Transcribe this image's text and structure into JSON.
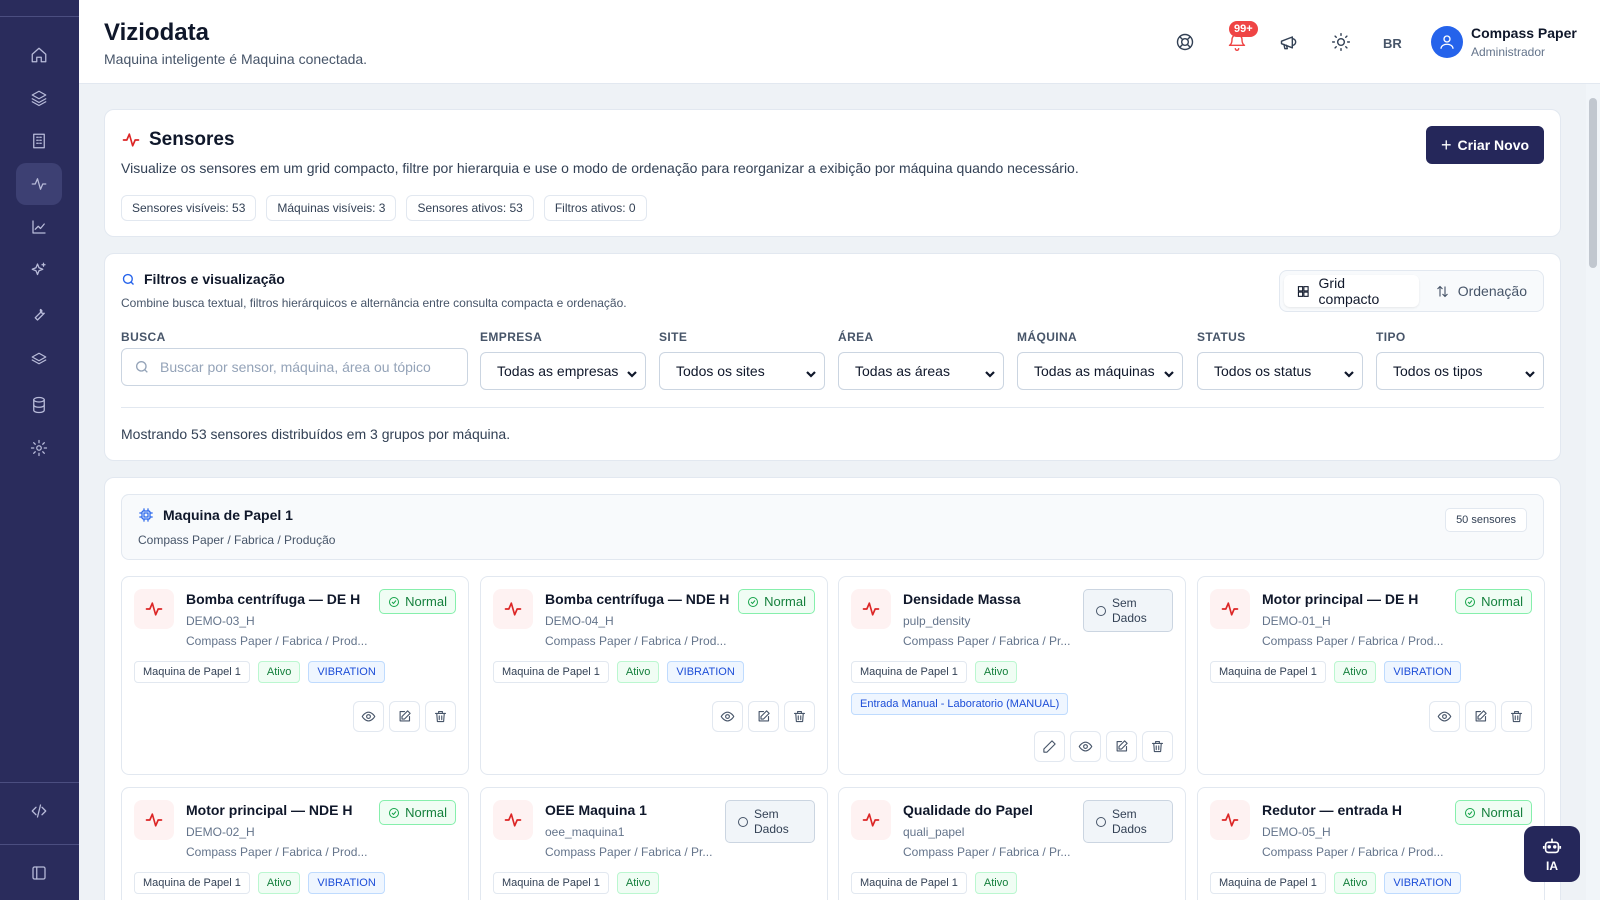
{
  "header": {
    "title": "Viziodata",
    "subtitle": "Maquina inteligente é Maquina conectada.",
    "notif_count": "99+",
    "lang": "BR",
    "user_name": "Compass Paper",
    "user_role": "Administrador"
  },
  "sidebar": {
    "items": [
      "home-icon",
      "layers-icon",
      "building-icon",
      "activity-icon",
      "chart-icon",
      "sparkles-icon",
      "wrench-icon",
      "stack-icon",
      "database-icon",
      "gear-icon"
    ],
    "active": "activity-icon"
  },
  "sensors_page": {
    "title": "Sensores",
    "description": "Visualize os sensores em um grid compacto, filtre por hierarquia e use o modo de ordenação para reorganizar a exibição por máquina quando necessário.",
    "create_label": "Criar Novo",
    "chips": [
      "Sensores visíveis: 53",
      "Máquinas visíveis: 3",
      "Sensores ativos: 53",
      "Filtros ativos: 0"
    ]
  },
  "filters": {
    "title": "Filtros e visualização",
    "subtitle": "Combine busca textual, filtros hierárquicos e alternância entre consulta compacta e ordenação.",
    "view_grid": "Grid compacto",
    "view_order": "Ordenação",
    "search_label": "BUSCA",
    "search_placeholder": "Buscar por sensor, máquina, área ou tópico",
    "selects": [
      {
        "label": "EMPRESA",
        "value": "Todas as empresas"
      },
      {
        "label": "SITE",
        "value": "Todos os sites"
      },
      {
        "label": "ÁREA",
        "value": "Todas as áreas"
      },
      {
        "label": "MÁQUINA",
        "value": "Todas as máquinas"
      },
      {
        "label": "STATUS",
        "value": "Todos os status"
      },
      {
        "label": "TIPO",
        "value": "Todos os tipos"
      }
    ],
    "summary": "Mostrando 53 sensores distribuídos em 3 grupos por máquina."
  },
  "group": {
    "name": "Maquina de Papel 1",
    "path": "Compass Paper / Fabrica / Produção",
    "count": "50 sensores"
  },
  "sensors": [
    {
      "name": "Bomba centrífuga — DE H",
      "code": "DEMO-03_H",
      "path": "Compass Paper / Fabrica / Prod...",
      "status": "Normal",
      "machine": "Maquina de Papel 1",
      "active": "Ativo",
      "type": "VIBRATION"
    },
    {
      "name": "Bomba centrífuga — NDE H",
      "code": "DEMO-04_H",
      "path": "Compass Paper / Fabrica / Prod...",
      "status": "Normal",
      "machine": "Maquina de Papel 1",
      "active": "Ativo",
      "type": "VIBRATION"
    },
    {
      "name": "Densidade Massa",
      "code": "pulp_density",
      "path": "Compass Paper / Fabrica / Pr...",
      "status": "Sem Dados",
      "machine": "Maquina de Papel 1",
      "active": "Ativo",
      "type": "",
      "extra": "Entrada Manual - Laboratorio (MANUAL)"
    },
    {
      "name": "Motor principal — DE H",
      "code": "DEMO-01_H",
      "path": "Compass Paper / Fabrica / Prod...",
      "status": "Normal",
      "machine": "Maquina de Papel 1",
      "active": "Ativo",
      "type": "VIBRATION"
    },
    {
      "name": "Motor principal — NDE H",
      "code": "DEMO-02_H",
      "path": "Compass Paper / Fabrica / Prod...",
      "status": "Normal",
      "machine": "Maquina de Papel 1",
      "active": "Ativo",
      "type": "VIBRATION"
    },
    {
      "name": "OEE Maquina 1",
      "code": "oee_maquina1",
      "path": "Compass Paper / Fabrica / Pr...",
      "status": "Sem Dados",
      "machine": "Maquina de Papel 1",
      "active": "Ativo",
      "type": ""
    },
    {
      "name": "Qualidade do Papel",
      "code": "quali_papel",
      "path": "Compass Paper / Fabrica / Pr...",
      "status": "Sem Dados",
      "machine": "Maquina de Papel 1",
      "active": "Ativo",
      "type": ""
    },
    {
      "name": "Redutor — entrada H",
      "code": "DEMO-05_H",
      "path": "Compass Paper / Fabrica / Prod...",
      "status": "Normal",
      "machine": "Maquina de Papel 1",
      "active": "Ativo",
      "type": "VIBRATION"
    }
  ],
  "ia_label": "IA",
  "colors": {
    "sidebar": "#2a2c5c",
    "primary": "#25275a",
    "accent_red": "#dc2626",
    "normal_green": "#15803d"
  }
}
